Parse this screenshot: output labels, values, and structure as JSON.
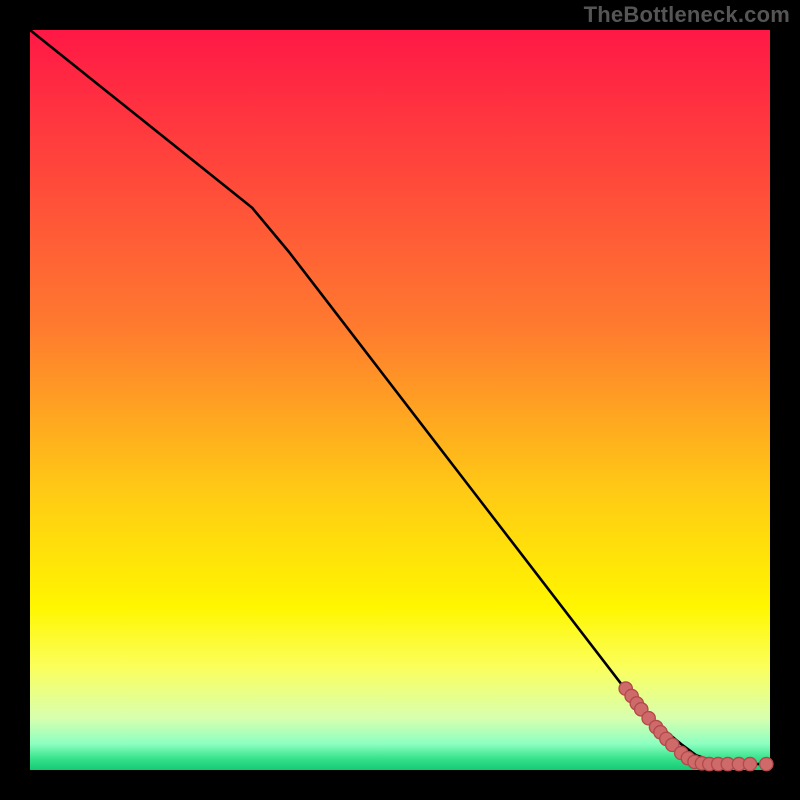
{
  "watermark": "TheBottleneck.com",
  "chart_data": {
    "type": "line",
    "title": "",
    "xlabel": "",
    "ylabel": "",
    "xlim": [
      0,
      100
    ],
    "ylim": [
      0,
      100
    ],
    "gradient_stops": [
      {
        "offset": 0.0,
        "color": "#ff1846"
      },
      {
        "offset": 0.4,
        "color": "#ff7a2f"
      },
      {
        "offset": 0.62,
        "color": "#ffc915"
      },
      {
        "offset": 0.78,
        "color": "#fff600"
      },
      {
        "offset": 0.86,
        "color": "#fbff5a"
      },
      {
        "offset": 0.93,
        "color": "#d8ffb0"
      },
      {
        "offset": 0.965,
        "color": "#8bffc0"
      },
      {
        "offset": 0.985,
        "color": "#35e28a"
      },
      {
        "offset": 1.0,
        "color": "#17c876"
      }
    ],
    "series": [
      {
        "name": "curve",
        "x": [
          0,
          5,
          10,
          15,
          20,
          25,
          30,
          35,
          40,
          45,
          50,
          55,
          60,
          65,
          70,
          75,
          80,
          82,
          85,
          88,
          90,
          93,
          95,
          100
        ],
        "y": [
          100,
          96,
          92,
          88,
          84,
          80,
          76,
          70,
          63.5,
          57,
          50.5,
          44,
          37.5,
          31,
          24.5,
          18,
          11.5,
          9,
          6,
          3.5,
          2.0,
          1.0,
          0.8,
          0.8
        ]
      }
    ],
    "markers": {
      "name": "points",
      "color": "#cf6a6a",
      "outline": "#b24a4a",
      "radius": 6,
      "data": [
        {
          "x": 80.5,
          "y": 11.0
        },
        {
          "x": 81.3,
          "y": 10.0
        },
        {
          "x": 82.0,
          "y": 9.0
        },
        {
          "x": 82.6,
          "y": 8.2
        },
        {
          "x": 83.6,
          "y": 7.0
        },
        {
          "x": 84.6,
          "y": 5.8
        },
        {
          "x": 85.2,
          "y": 5.1
        },
        {
          "x": 86.0,
          "y": 4.2
        },
        {
          "x": 86.8,
          "y": 3.4
        },
        {
          "x": 88.0,
          "y": 2.3
        },
        {
          "x": 88.9,
          "y": 1.6
        },
        {
          "x": 89.8,
          "y": 1.1
        },
        {
          "x": 90.8,
          "y": 0.9
        },
        {
          "x": 91.8,
          "y": 0.8
        },
        {
          "x": 93.0,
          "y": 0.8
        },
        {
          "x": 94.3,
          "y": 0.8
        },
        {
          "x": 95.8,
          "y": 0.8
        },
        {
          "x": 97.3,
          "y": 0.8
        },
        {
          "x": 99.5,
          "y": 0.8
        }
      ]
    }
  }
}
